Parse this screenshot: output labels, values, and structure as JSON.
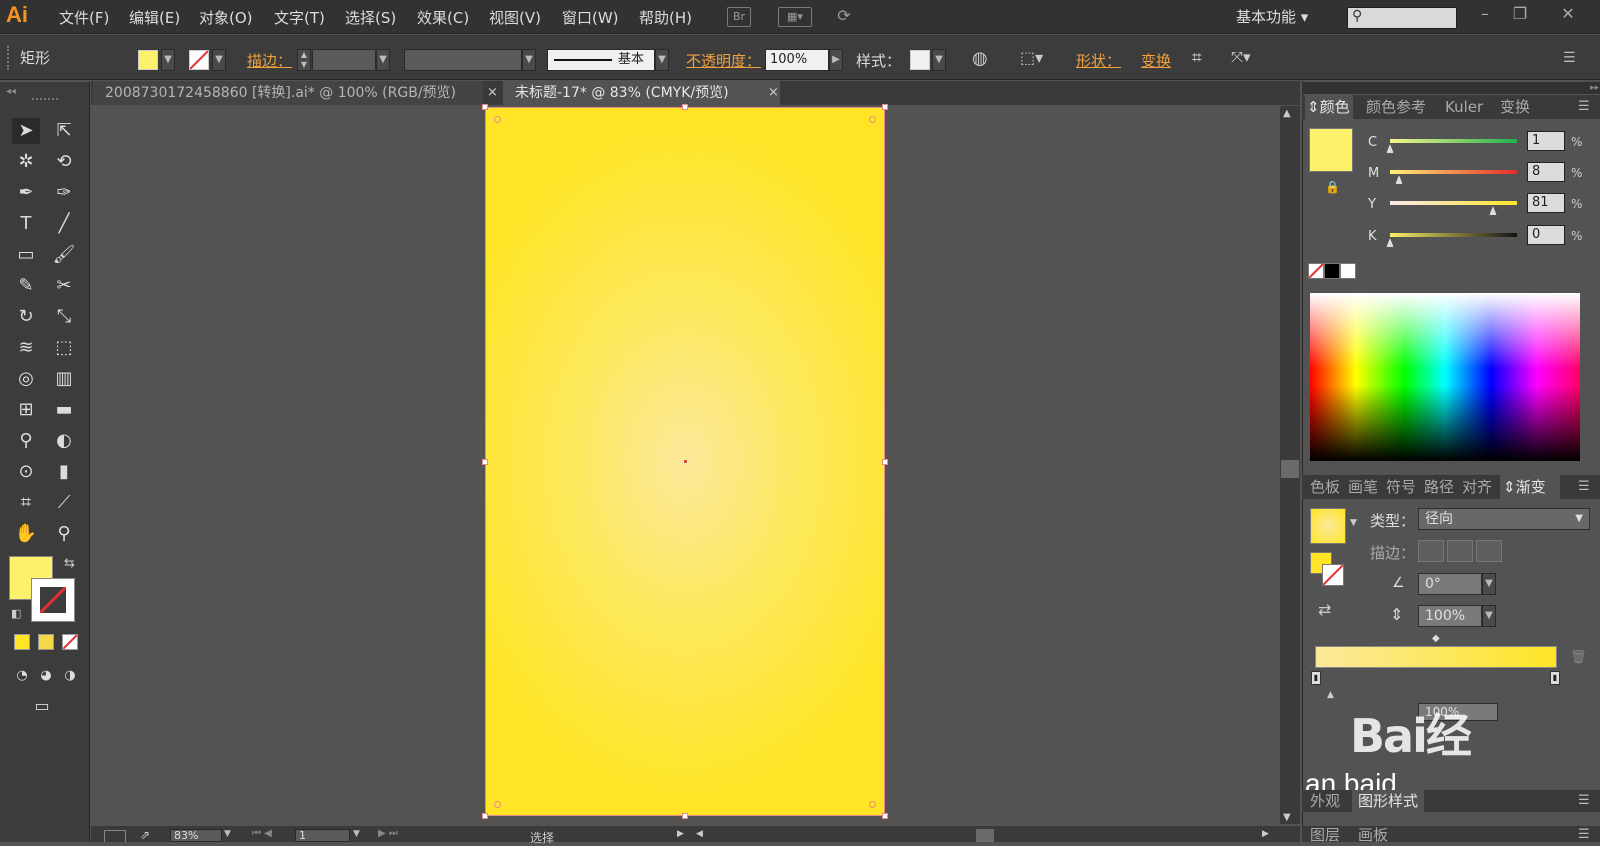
{
  "app": {
    "logo": "Ai"
  },
  "menu": [
    "文件(F)",
    "编辑(E)",
    "对象(O)",
    "文字(T)",
    "选择(S)",
    "效果(C)",
    "视图(V)",
    "窗口(W)",
    "帮助(H)"
  ],
  "topbar": {
    "bridge_label": "Br",
    "workspace": "基本功能"
  },
  "control": {
    "tool_name": "矩形",
    "stroke_label": "描边：",
    "stroke_style": "基本",
    "opacity_label": "不透明度：",
    "opacity_value": "100%",
    "style_label": "样式：",
    "shape_label": "形状：",
    "transform_label": "变换"
  },
  "tabs": [
    {
      "label": "2008730172458860 [转换].ai* @ 100% (RGB/预览)",
      "close": "×"
    },
    {
      "label": "未标题-17* @ 83% (CMYK/预览)",
      "close": "×"
    }
  ],
  "status": {
    "zoom": "83%",
    "page": "1",
    "mode": "选择"
  },
  "color_panel": {
    "tabs": [
      "颜色",
      "颜色参考",
      "Kuler",
      "变换"
    ],
    "channels": [
      {
        "label": "C",
        "value": "1",
        "unit": "%"
      },
      {
        "label": "M",
        "value": "8",
        "unit": "%"
      },
      {
        "label": "Y",
        "value": "81",
        "unit": "%"
      },
      {
        "label": "K",
        "value": "0",
        "unit": "%"
      }
    ],
    "fill_color": "#fdf06a"
  },
  "gradient_panel": {
    "tabs": [
      "色板",
      "画笔",
      "符号",
      "路径",
      "对齐",
      "渐变"
    ],
    "type_label": "类型：",
    "type_value": "径向",
    "stroke_label": "描边：",
    "angle_value": "0°",
    "aspect_value": "100%",
    "opacity_value": "100%",
    "start_color": "#fbe99b",
    "end_color": "#ffe526"
  },
  "bottom_panels": {
    "tabs1": [
      "外观",
      "图形样式"
    ],
    "tabs2": [
      "图层",
      "画板"
    ]
  },
  "watermark": "Bai 经验 jingyan.baidu"
}
